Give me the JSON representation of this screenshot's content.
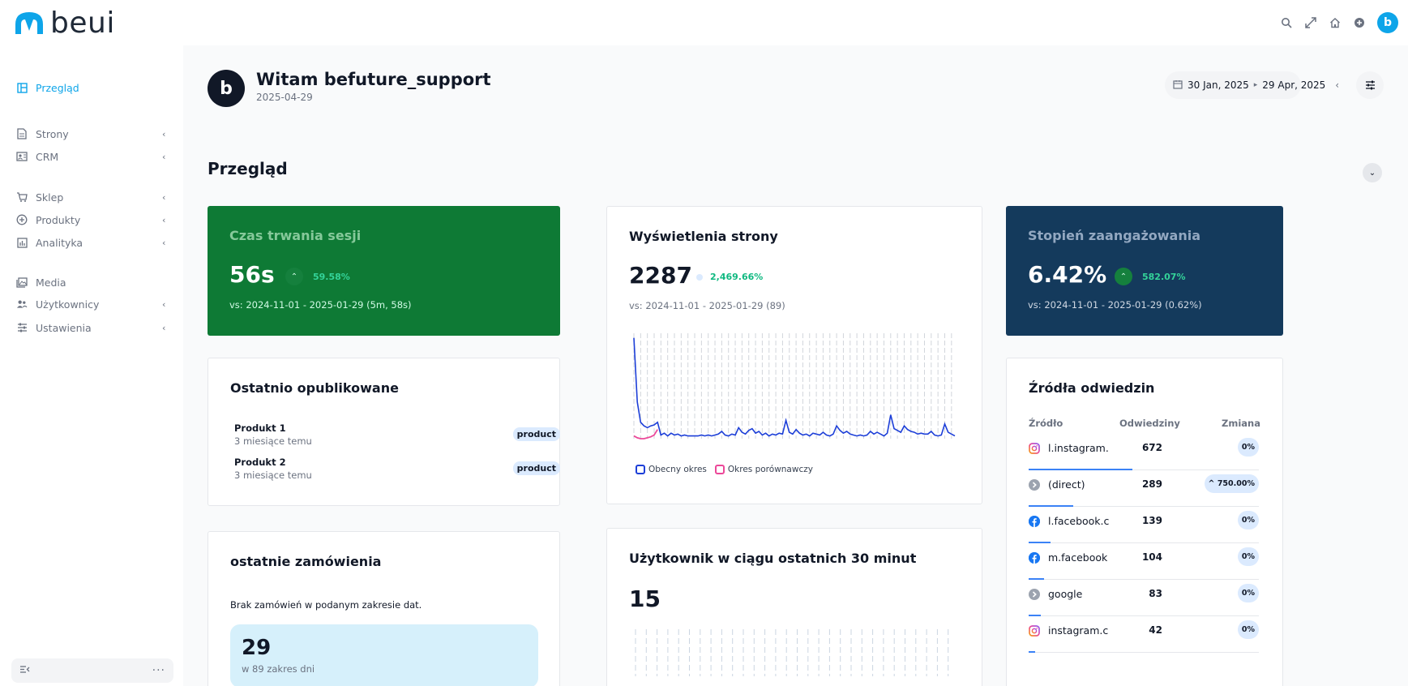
{
  "app": {
    "name": "beui"
  },
  "topbar": {
    "avatar_letter": "b"
  },
  "sidebar": {
    "items": [
      {
        "label": "Przegląd",
        "icon": "dashboard-icon",
        "active": true,
        "chevron": false
      },
      {
        "label": "Strony",
        "icon": "page-icon",
        "active": false,
        "chevron": true
      },
      {
        "label": "CRM",
        "icon": "contact-card-icon",
        "active": false,
        "chevron": true
      },
      {
        "label": "Sklep",
        "icon": "cart-icon",
        "active": false,
        "chevron": true
      },
      {
        "label": "Produkty",
        "icon": "plus-circle-icon",
        "active": false,
        "chevron": true
      },
      {
        "label": "Analityka",
        "icon": "bar-chart-icon",
        "active": false,
        "chevron": true
      },
      {
        "label": "Media",
        "icon": "images-icon",
        "active": false,
        "chevron": false
      },
      {
        "label": "Użytkownicy",
        "icon": "users-icon",
        "active": false,
        "chevron": true
      },
      {
        "label": "Ustawienia",
        "icon": "sliders-icon",
        "active": false,
        "chevron": true
      }
    ]
  },
  "header": {
    "avatar_letter": "b",
    "title": "Witam befuture_support",
    "date": "2025-04-29",
    "date_from": "30 Jan, 2025",
    "date_to": "29 Apr, 2025"
  },
  "section": {
    "title": "Przegląd"
  },
  "kpi_session": {
    "title": "Czas trwania sesji",
    "value": "56s",
    "change": "59.58%",
    "vs": "vs: 2024-11-01 - 2025-01-29 (5m, 58s)"
  },
  "kpi_views": {
    "title": "Wyświetlenia strony",
    "value": "2287",
    "change": "2,469.66%",
    "vs": "vs: 2024-11-01 - 2025-01-29 (89)",
    "legend_current": "Obecny okres",
    "legend_compare": "Okres porównawczy"
  },
  "kpi_engagement": {
    "title": "Stopień zaangażowania",
    "value": "6.42%",
    "change": "582.07%",
    "vs": "vs: 2024-11-01 - 2025-01-29 (0.62%)"
  },
  "recent": {
    "title": "Ostatnio opublikowane",
    "items": [
      {
        "name": "Produkt 1",
        "time": "3 miesiące temu",
        "badge": "product"
      },
      {
        "name": "Produkt 2",
        "time": "3 miesiące temu",
        "badge": "product"
      }
    ]
  },
  "orders": {
    "title": "ostatnie zamówienia",
    "empty": "Brak zamówień w podanym zakresie dat.",
    "count": "29",
    "count_sub": "w 89 zakres dni"
  },
  "users30": {
    "title": "Użytkownik w ciągu ostatnich 30 minut",
    "count": "15"
  },
  "sources": {
    "title": "Źródła odwiedzin",
    "col_source": "Źródło",
    "col_visits": "Odwiedziny",
    "col_change": "Zmiana",
    "rows": [
      {
        "name": "l.instagram.",
        "visits": "672",
        "change": "0%",
        "share": 1.0,
        "icon": "instagram-icon"
      },
      {
        "name": "(direct)",
        "visits": "289",
        "change": "^ 750.00%",
        "share": 0.43,
        "icon": "direct-icon"
      },
      {
        "name": "l.facebook.c",
        "visits": "139",
        "change": "0%",
        "share": 0.21,
        "icon": "facebook-icon"
      },
      {
        "name": "m.facebook",
        "visits": "104",
        "change": "0%",
        "share": 0.15,
        "icon": "facebook-icon"
      },
      {
        "name": "google",
        "visits": "83",
        "change": "0%",
        "share": 0.12,
        "icon": "direct-icon"
      },
      {
        "name": "instagram.c",
        "visits": "42",
        "change": "0%",
        "share": 0.06,
        "icon": "instagram-icon"
      }
    ]
  },
  "chart_data": {
    "type": "line",
    "series": [
      {
        "name": "Obecny okres",
        "values": [
          110,
          40,
          18,
          14,
          12,
          14,
          15,
          18,
          4,
          6,
          3,
          6,
          4,
          5,
          3,
          4,
          3,
          3,
          3,
          3,
          4,
          3,
          4,
          3,
          4,
          5,
          8,
          4,
          3,
          5,
          4,
          12,
          7,
          5,
          9,
          11,
          6,
          8,
          4,
          6,
          3,
          5,
          4,
          6,
          5,
          20,
          7,
          5,
          10,
          6,
          4,
          5,
          3,
          6,
          5,
          4,
          7,
          4,
          3,
          5,
          14,
          9,
          6,
          8,
          5,
          4,
          3,
          4,
          3,
          4,
          8,
          5,
          7,
          5,
          3,
          6,
          26,
          11,
          9,
          7,
          14,
          10,
          8,
          7,
          5,
          6,
          5,
          5,
          8,
          4,
          3,
          4,
          16,
          7,
          5,
          3
        ],
        "color": "#1d3fd8"
      },
      {
        "name": "Okres porównawczy",
        "values": [
          3,
          1,
          0,
          0,
          1,
          2,
          4,
          10
        ],
        "color": "#ec4899"
      }
    ],
    "ylim": [
      0,
      115
    ]
  },
  "colors": {
    "accent": "#0ea5e9",
    "kpi_green": "#0e7a35",
    "kpi_blue": "#143a5c",
    "positive": "#10b981"
  }
}
